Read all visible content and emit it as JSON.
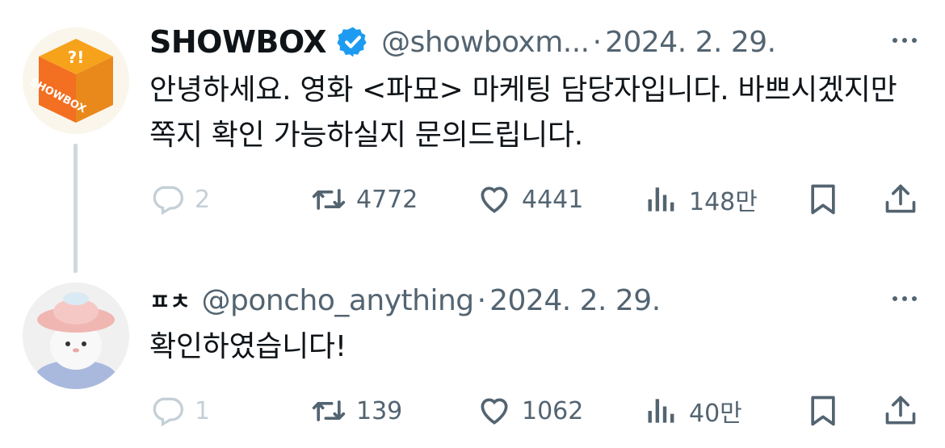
{
  "tweets": [
    {
      "name": "SHOWBOX",
      "handle": "@showboxm...",
      "separator": "·",
      "date": "2024. 2. 29.",
      "text": "안녕하세요. 영화 <파묘> 마케팅 담당자입니다. 바쁘시겠지만 쪽지 확인 가능하실지 문의드립니다.",
      "verified": true,
      "avatar_text": "SHOWBOX",
      "actions": {
        "replies": "2",
        "retweets": "4772",
        "likes": "4441",
        "views": "148만"
      }
    },
    {
      "name": "ㅍㅊ",
      "handle": "@poncho_anything",
      "separator": "·",
      "date": "2024. 2. 29.",
      "text": "확인하였습니다!",
      "verified": false,
      "actions": {
        "replies": "1",
        "retweets": "139",
        "likes": "1062",
        "views": "40만"
      }
    }
  ],
  "colors": {
    "verified": "#1d9bf0",
    "muted": "#536471",
    "accent": "#f36f21"
  },
  "icons": [
    "reply-icon",
    "retweet-icon",
    "heart-icon",
    "views-icon",
    "bookmark-icon",
    "share-icon",
    "more-icon",
    "verified-badge-icon"
  ]
}
